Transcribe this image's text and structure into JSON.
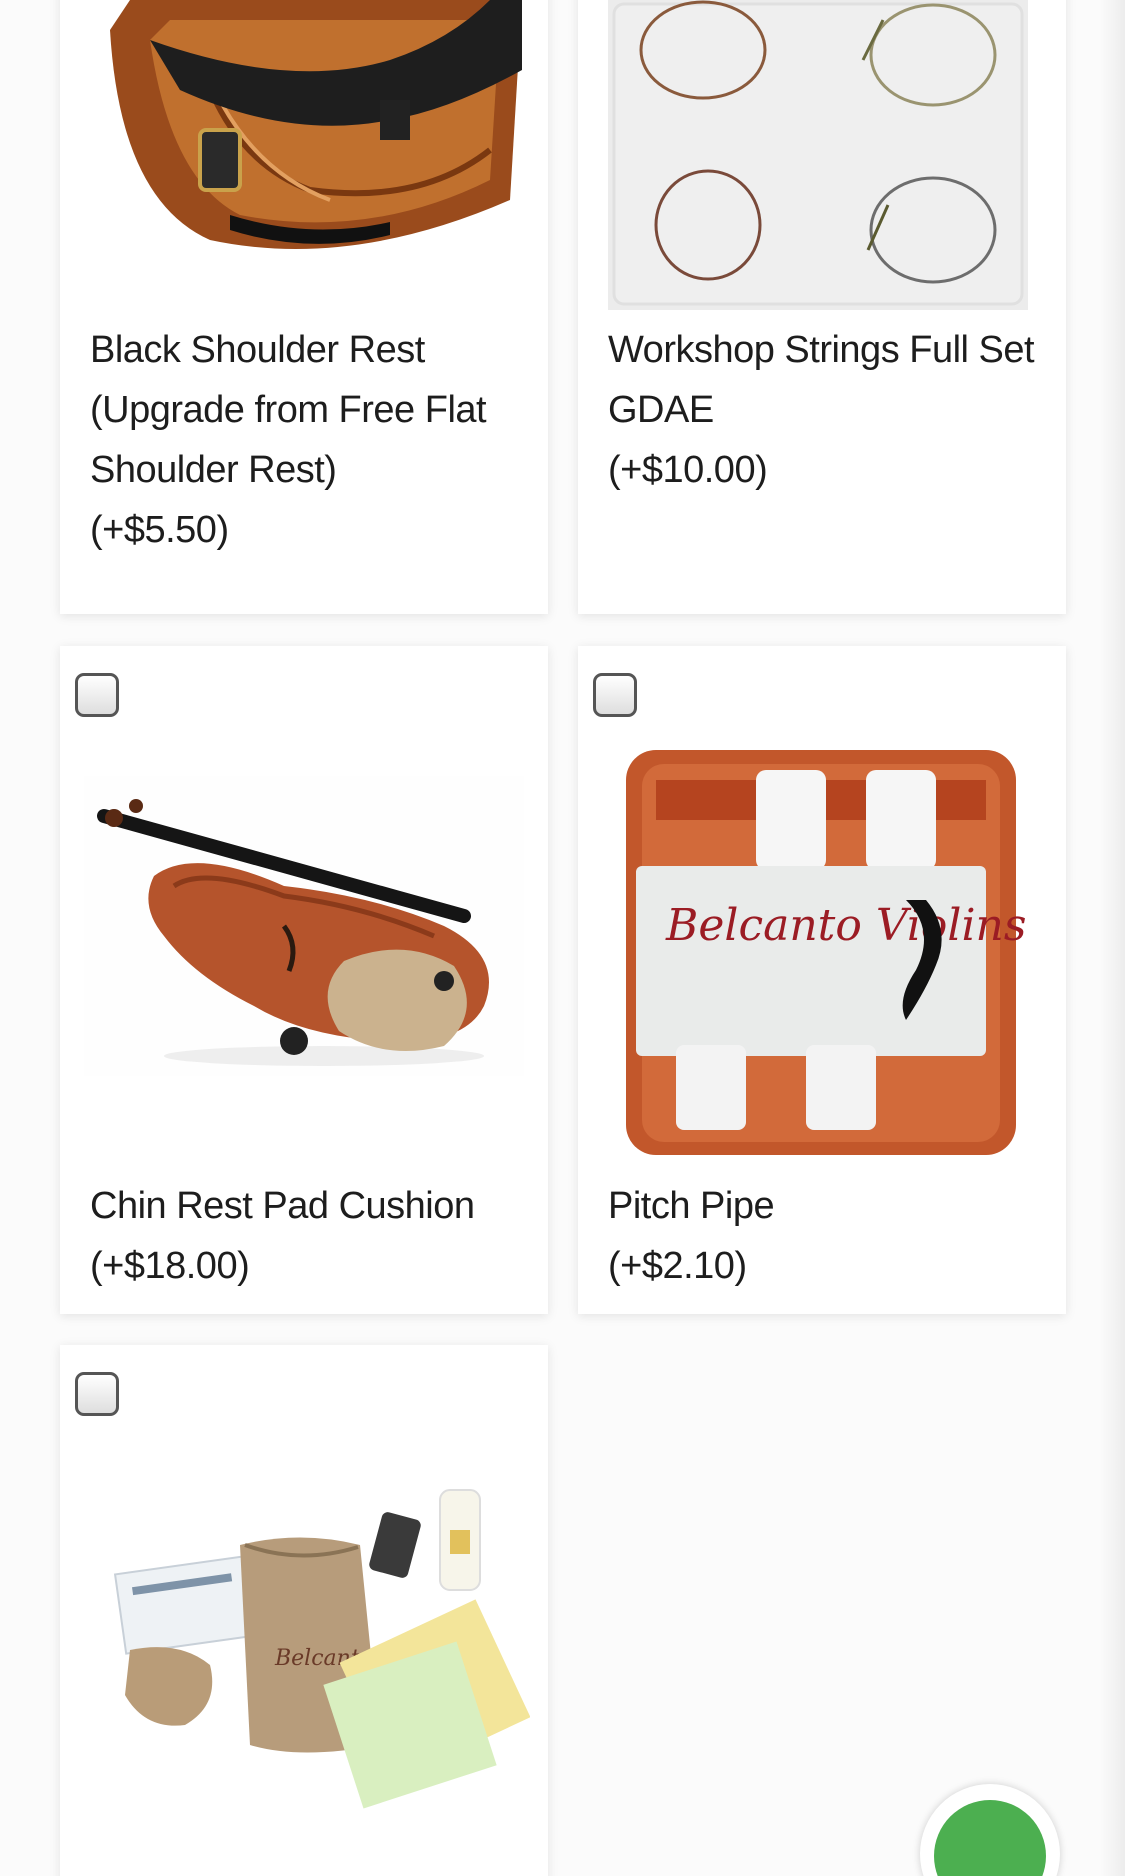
{
  "products": [
    {
      "name": "Black Shoulder Rest (Upgrade from Free Flat Shoulder Rest)",
      "price": "(+$5.50)",
      "icon": "shoulder-rest-image"
    },
    {
      "name": "Workshop Strings Full Set GDAE",
      "price": "(+$10.00)",
      "icon": "strings-image"
    },
    {
      "name": "Chin Rest Pad Cushion",
      "price": "(+$18.00)",
      "icon": "chinrest-pad-image"
    },
    {
      "name": "Pitch Pipe",
      "price": "(+$2.10)",
      "icon": "pitch-pipe-image",
      "brand_text": "Belcanto Violins"
    },
    {
      "name": "",
      "price": "",
      "icon": "accessory-kit-image"
    }
  ],
  "colors": {
    "card_bg": "#ffffff",
    "page_bg": "#fbfbfb",
    "fab_green": "#4caf50",
    "text": "#1d1d1d"
  }
}
